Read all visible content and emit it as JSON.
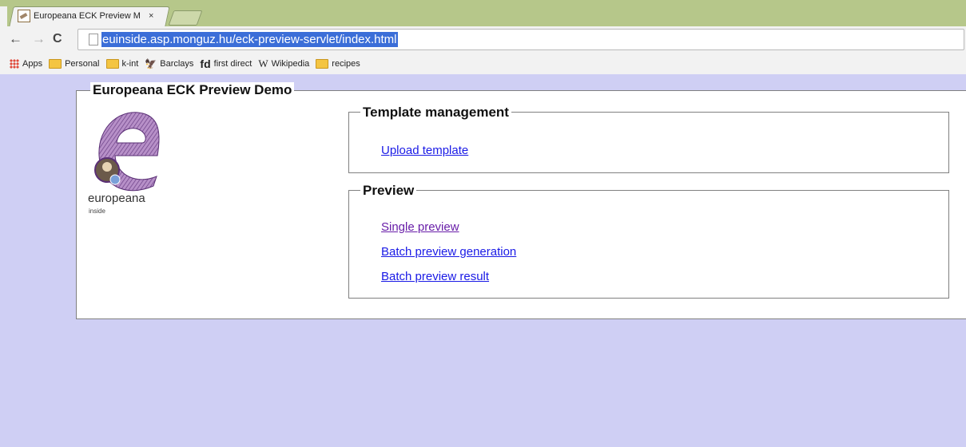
{
  "browser": {
    "tab_title": "Europeana ECK Preview M",
    "tab_close": "×",
    "url": "euinside.asp.monguz.hu/eck-preview-servlet/index.html",
    "nav": {
      "back": "←",
      "forward": "→",
      "reload": "C"
    },
    "bookmarks": [
      {
        "label": "Apps",
        "icon": "apps-icon"
      },
      {
        "label": "Personal",
        "icon": "folder-icon"
      },
      {
        "label": "k-int",
        "icon": "folder-icon"
      },
      {
        "label": "Barclays",
        "icon": "barclays-icon"
      },
      {
        "label": "first direct",
        "icon": "first-direct-icon",
        "icon_text": "fd"
      },
      {
        "label": "Wikipedia",
        "icon": "wikipedia-icon",
        "icon_text": "W"
      },
      {
        "label": "recipes",
        "icon": "folder-icon"
      }
    ]
  },
  "page": {
    "background": "#cfcff4",
    "title": "Europeana ECK Preview Demo",
    "logo": {
      "word": "europeana",
      "sub": "inside"
    },
    "template_management": {
      "heading": "Template management",
      "links": [
        "Upload template"
      ]
    },
    "preview": {
      "heading": "Preview",
      "links": [
        "Single preview",
        "Batch preview generation",
        "Batch preview result"
      ]
    },
    "link_color": "#1a1ae6",
    "visited_link_color": "#681da8"
  }
}
